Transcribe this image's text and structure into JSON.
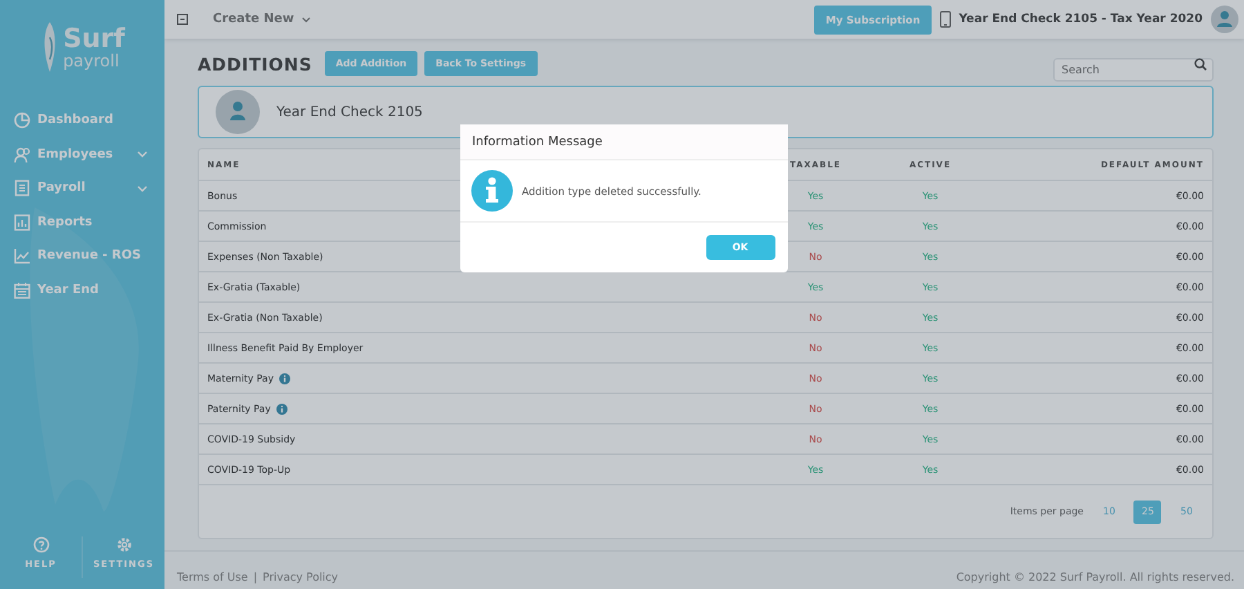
{
  "sidebar": {
    "logo": {
      "word": "Surf",
      "sub": "payroll"
    },
    "items": [
      {
        "label": "Dashboard",
        "has_submenu": false
      },
      {
        "label": "Employees",
        "has_submenu": true
      },
      {
        "label": "Payroll",
        "has_submenu": true
      },
      {
        "label": "Reports",
        "has_submenu": false
      },
      {
        "label": "Revenue - ROS",
        "has_submenu": false
      },
      {
        "label": "Year End",
        "has_submenu": false
      }
    ],
    "bottom": [
      {
        "label": "HELP"
      },
      {
        "label": "SETTINGS"
      }
    ]
  },
  "topbar": {
    "create_new": "Create New",
    "subscription": "My Subscription",
    "company": "Year End Check 2105 - Tax Year 2020"
  },
  "page": {
    "title": "ADDITIONS",
    "buttons": [
      "Add Addition",
      "Back To Settings"
    ],
    "search": {
      "placeholder": "Search"
    },
    "employer": "Year End Check 2105"
  },
  "table": {
    "columns": [
      "NAME",
      "TAXABLE",
      "ACTIVE",
      "DEFAULT AMOUNT"
    ],
    "rows": [
      {
        "name": "Bonus",
        "info": false,
        "taxable": "Yes",
        "taxable_on": true,
        "active": "Yes",
        "active_on": true,
        "amount": "€0.00"
      },
      {
        "name": "Commission",
        "info": false,
        "taxable": "Yes",
        "taxable_on": true,
        "active": "Yes",
        "active_on": true,
        "amount": "€0.00"
      },
      {
        "name": "Expenses (Non Taxable)",
        "info": false,
        "taxable": "No",
        "taxable_on": false,
        "active": "Yes",
        "active_on": true,
        "amount": "€0.00"
      },
      {
        "name": "Ex-Gratia (Taxable)",
        "info": false,
        "taxable": "Yes",
        "taxable_on": true,
        "active": "Yes",
        "active_on": true,
        "amount": "€0.00"
      },
      {
        "name": "Ex-Gratia (Non Taxable)",
        "info": false,
        "taxable": "No",
        "taxable_on": false,
        "active": "Yes",
        "active_on": true,
        "amount": "€0.00"
      },
      {
        "name": "Illness Benefit Paid By Employer",
        "info": false,
        "taxable": "No",
        "taxable_on": false,
        "active": "Yes",
        "active_on": true,
        "amount": "€0.00"
      },
      {
        "name": "Maternity Pay",
        "info": true,
        "taxable": "No",
        "taxable_on": false,
        "active": "Yes",
        "active_on": true,
        "amount": "€0.00"
      },
      {
        "name": "Paternity Pay",
        "info": true,
        "taxable": "No",
        "taxable_on": false,
        "active": "Yes",
        "active_on": true,
        "amount": "€0.00"
      },
      {
        "name": "COVID-19 Subsidy",
        "info": false,
        "taxable": "No",
        "taxable_on": false,
        "active": "Yes",
        "active_on": true,
        "amount": "€0.00"
      },
      {
        "name": "COVID-19 Top-Up",
        "info": false,
        "taxable": "Yes",
        "taxable_on": true,
        "active": "Yes",
        "active_on": true,
        "amount": "€0.00"
      }
    ],
    "pager": {
      "label": "Items per page",
      "sizes": [
        {
          "label": "10",
          "selected": false
        },
        {
          "label": "25",
          "selected": true
        },
        {
          "label": "50",
          "selected": false
        }
      ]
    }
  },
  "footer": {
    "links": [
      "Terms of Use",
      "Privacy Policy"
    ],
    "separator": "|",
    "copyright": "Copyright © 2022 Surf Payroll. All rights reserved."
  },
  "dialog": {
    "title": "Information Message",
    "message": "Addition type deleted successfully.",
    "button": "OK"
  }
}
